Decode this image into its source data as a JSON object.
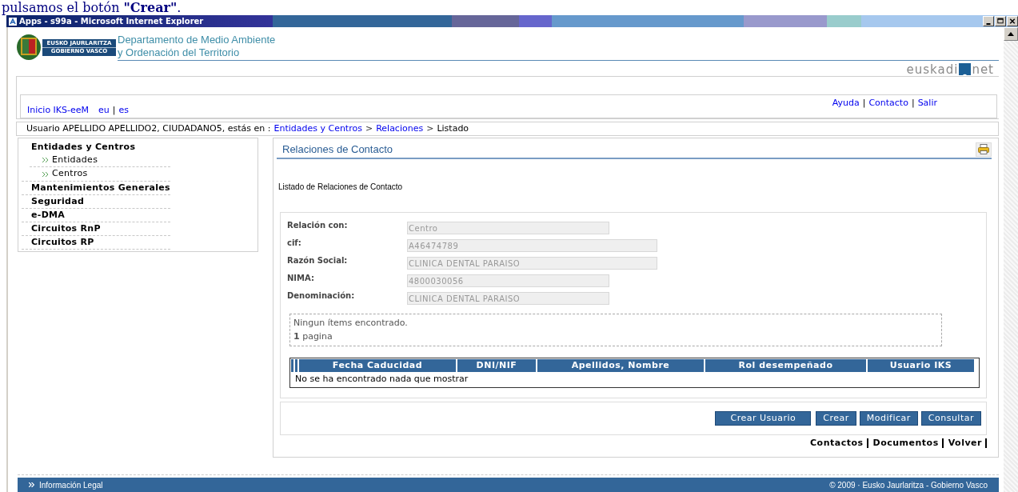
{
  "caption": "pulsamos el botón **\"Crear\"**.",
  "window": {
    "title": "Apps - s99a - Microsoft Internet Explorer"
  },
  "header": {
    "logo_text": [
      "EUSKO JAURLARITZA",
      "GOBIERNO VASCO"
    ],
    "department": [
      "Departamento de Medio Ambiente",
      "y Ordenación del Territorio"
    ],
    "portal_logo": [
      "euskadi",
      "net"
    ]
  },
  "top_links": {
    "home": "Inicio IKS-eeM",
    "languages": [
      "eu",
      "es"
    ],
    "right": [
      "Ayuda",
      "Contacto",
      "Salir"
    ],
    "separator": "|"
  },
  "breadcrumb": {
    "prefix": "Usuario APELLIDO APELLIDO2, CIUDADANO5, estás en :",
    "separator": ">",
    "items": [
      {
        "label": "Entidades y Centros",
        "link": true
      },
      {
        "label": "Relaciones",
        "link": true
      },
      {
        "label": "Listado",
        "link": false
      }
    ]
  },
  "sidebar": [
    {
      "label": "Entidades y Centros",
      "children": [
        {
          "label": "Entidades"
        },
        {
          "label": "Centros"
        }
      ]
    },
    {
      "label": "Mantenimientos Generales"
    },
    {
      "label": "Seguridad"
    },
    {
      "label": "e-DMA"
    },
    {
      "label": "Circuitos RnP"
    },
    {
      "label": "Circuitos RP"
    }
  ],
  "panel": {
    "title": "Relaciones de Contacto",
    "subtitle": "Listado de Relaciones de Contacto",
    "fields": [
      {
        "label": "Relación con:",
        "value": "Centro",
        "kind": "short"
      },
      {
        "label": "cif:",
        "value": "A46474789",
        "kind": "long"
      },
      {
        "label": "Razón Social:",
        "value": "CLINICA DENTAL PARAISO",
        "kind": "long"
      },
      {
        "label": "NIMA:",
        "value": "4800030056",
        "kind": "short"
      },
      {
        "label": "Denominación:",
        "value": "CLINICA DENTAL PARAISO",
        "kind": "short"
      }
    ],
    "results": {
      "message": "Ningun ítems encontrado.",
      "pages": "**1** pagina"
    },
    "table": {
      "columns": [
        "Fecha Caducidad",
        "DNI/NIF",
        "Apellidos, Nombre",
        "Rol desempeñado",
        "Usuario IKS"
      ],
      "empty": "No se ha encontrado nada que mostrar"
    },
    "buttons": [
      "Crear Usuario",
      "Crear",
      "Modificar",
      "Consultar"
    ],
    "links": [
      "Contactos",
      "Documentos",
      "Volver"
    ]
  },
  "footer": {
    "left": "Información Legal",
    "right": "© 2009 · Eusko Jaurlaritza - Gobierno Vasco"
  }
}
